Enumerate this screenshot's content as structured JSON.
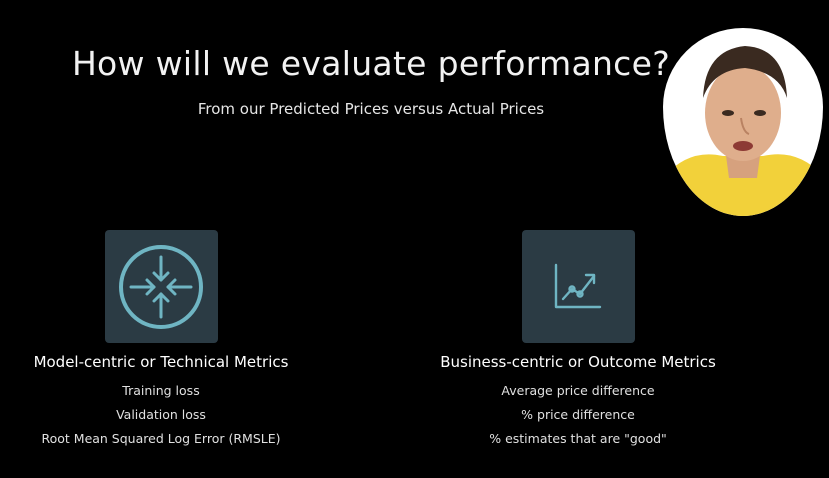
{
  "slide": {
    "title": "How will we evaluate performance?",
    "subtitle": "From our Predicted Prices versus Actual Prices"
  },
  "columns": [
    {
      "icon": "arrows-converge-icon",
      "heading": "Model-centric or Technical Metrics",
      "items": [
        "Training loss",
        "Validation loss",
        "Root Mean Squared Log Error (RMSLE)"
      ]
    },
    {
      "icon": "line-chart-trend-icon",
      "heading": "Business-centric or Outcome Metrics",
      "items": [
        "Average price difference",
        "% price difference",
        "% estimates that are \"good\""
      ]
    }
  ],
  "colors": {
    "background": "#000000",
    "icon_box": "#2b3b44",
    "icon_accent": "#6fb5c3",
    "text": "#ffffff"
  }
}
